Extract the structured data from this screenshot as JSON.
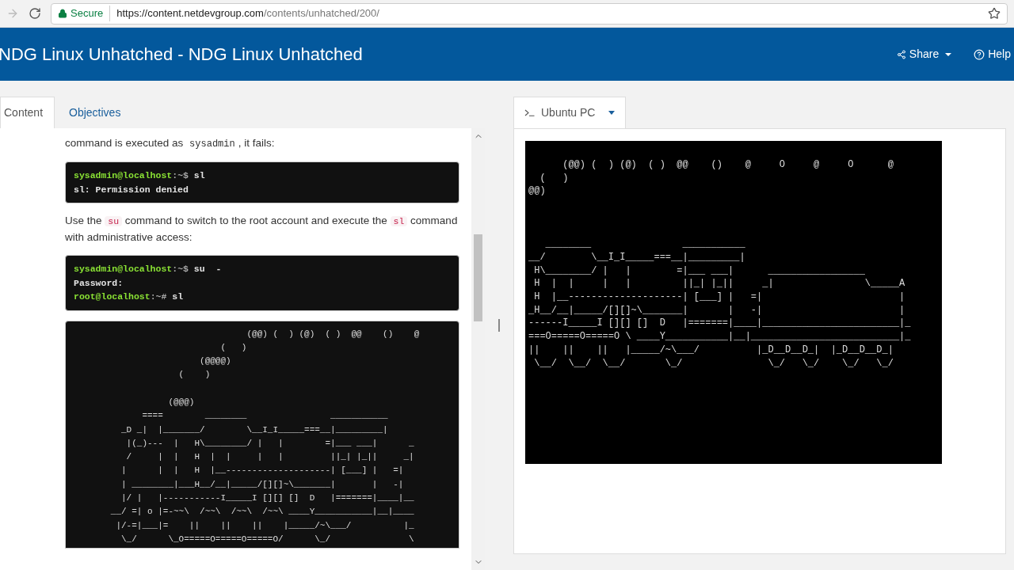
{
  "browser": {
    "secure_label": "Secure",
    "url_host": "https://content.netdevgroup.com",
    "url_path": "/contents/unhatched/200/"
  },
  "header": {
    "title": "NDG Linux Unhatched - NDG Linux Unhatched",
    "actions": [
      {
        "label": "Share",
        "kind": "share"
      },
      {
        "label": "Help",
        "kind": "help"
      }
    ]
  },
  "left_tabs": [
    {
      "label": "Content",
      "selected": true
    },
    {
      "label": "Objectives",
      "selected": false
    }
  ],
  "content": [
    {
      "kind": "paragraph",
      "parts": [
        {
          "kind": "text",
          "text": "command is executed as "
        },
        {
          "kind": "mono",
          "text": "sysadmin"
        },
        {
          "kind": "text",
          "text": ", it fails:"
        }
      ]
    },
    {
      "kind": "terminal",
      "lines": [
        {
          "kind": "prompt",
          "user": "sysadmin@localhost",
          "path": ":~$",
          "command": " sl"
        },
        {
          "kind": "output",
          "text": "sl: Permission denied"
        }
      ]
    },
    {
      "kind": "paragraph",
      "parts": [
        {
          "kind": "text",
          "text": "Use the "
        },
        {
          "kind": "code",
          "text": "su"
        },
        {
          "kind": "text",
          "text": " command to switch to the root account and execute the "
        },
        {
          "kind": "code",
          "text": "sl"
        },
        {
          "kind": "text",
          "text": " command with administrative access:"
        }
      ]
    },
    {
      "kind": "terminal",
      "lines": [
        {
          "kind": "prompt",
          "user": "sysadmin@localhost",
          "path": ":~$",
          "command": " su  -"
        },
        {
          "kind": "output",
          "text": "Password:"
        },
        {
          "kind": "prompt",
          "user": "root@localhost",
          "path": ":~#",
          "command": " sl"
        }
      ]
    },
    {
      "kind": "art",
      "text": "                                  (@@) (  ) (@)  ( )  @@    ()    @\n                             (   )\n                         (@@@@)\n                     (    )\n\n                   (@@@)\n              ====        ________                ___________\n          _D _|  |_______/        \\__I_I_____===__|_________|\n           |(_)---  |   H\\________/ |   |        =|___ ___|      _\n           /     |  |   H  |  |     |   |         ||_| |_||     _|\n          |      |  |   H  |__--------------------| [___] |   =|\n          | ________|___H__/__|_____/[][]~\\_______|       |   -|\n          |/ |   |-----------I_____I [][] []  D   |=======|____|__\n        __/ =| o |=-~~\\  /~~\\  /~~\\  /~~\\ ____Y___________|__|____\n         |/-=|___|=    ||    ||    ||    |_____/~\\___/          |_\n          \\_/      \\_O=====O=====O=====O/      \\_/               \\"
    }
  ],
  "right_panel": {
    "tab": {
      "label": "Ubuntu PC"
    },
    "terminal": "      (@@) (  ) (@)  ( )  @@    ()    @     O     @     O      @\n  (   )\n@@)\n\n\n\n   ________                ___________\n__/        \\__I_I_____===__|_________|\n H\\________/ |   |        =|___ ___|      _________________\n H  |  |     |   |         ||_| |_||     _|                \\_____A\n H  |__--------------------| [___] |   =|                        |\n_H__/__|_____/[][]~\\_______|       |   -|                        |\n------I_____I [][] []  D   |=======|____|________________________|_\n===O=====O=====O \\ ____Y___________|__|__________________________|_\n||    ||    ||   |_____/~\\___/          |_D__D__D_|  |_D__D__D_|\n \\__/  \\__/  \\__/       \\_/               \\_/   \\_/    \\_/   \\_/"
  }
}
